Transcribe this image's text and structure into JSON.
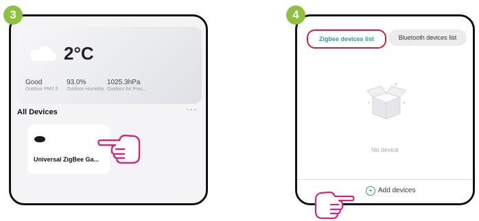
{
  "steps": {
    "left": "3",
    "right": "4"
  },
  "weather": {
    "icon": "cloud-icon",
    "temperature": "2°C",
    "pm_value": "Good",
    "pm_label": "Outdoor PM2.5",
    "humidity_value": "93.0%",
    "humidity_label": "Outdoor Humidity",
    "pressure_value": "1025.3hPa",
    "pressure_label": "Outdoor Air Pres..."
  },
  "devices": {
    "heading": "All Devices",
    "more": "···",
    "items": [
      {
        "name": "Universal ZigBee Ga...",
        "icon": "zigbee-gateway-icon"
      }
    ]
  },
  "tabs": [
    {
      "label": "Zigbee devices list",
      "selected": true
    },
    {
      "label": "Bluetooth devices list",
      "selected": false
    }
  ],
  "empty_state": {
    "icon": "empty-box-icon",
    "text": "No device"
  },
  "add_devices": {
    "icon": "plus-circle-icon",
    "label": "Add devices"
  },
  "colors": {
    "badge": "#8dc13f",
    "accent": "#2a9d8f",
    "highlight": "#cc2232",
    "hand": "#d6267b"
  }
}
